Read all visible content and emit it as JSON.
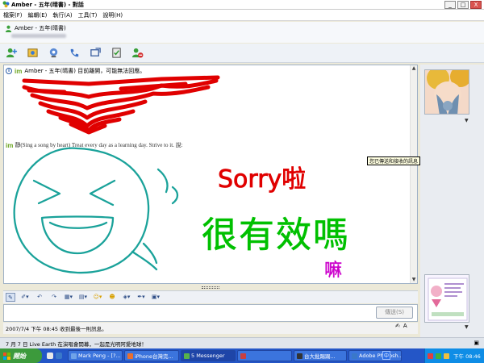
{
  "window": {
    "title": "Amber - 五年(晴書) - 對話",
    "minimize": "_",
    "maximize": "□",
    "close": "X"
  },
  "menu": [
    "檔案(F)",
    "編輯(E)",
    "執行(A)",
    "工具(T)",
    "說明(H)"
  ],
  "contact": {
    "name": "Amber - 五年(晴書)"
  },
  "conversation": {
    "away_notice": "Amber - 五年(晴書) 目前離開，可能無法回應。",
    "im_logo": "im",
    "message": "靜(Sing a song by heart) Treat every day as a learning day. Strive to it. 說:",
    "tooltip": "您已傳送和接收的訊息",
    "handwriting": {
      "line1": "Sorry啦",
      "line2": "很有效嗎",
      "line3": "嘛"
    }
  },
  "compose": {
    "send_label": "傳送(S)"
  },
  "status": {
    "last_message": "2007/7/4 下午 08:45 收到最後一則訊息。",
    "news": "7 月 7 日 Live Earth 在演唱會開幕，一起是光明阿愛地球！"
  },
  "taskbar": {
    "start_label": "開始",
    "items": [
      {
        "label": "Mark Peng - [?...",
        "color": "#6fa3e8"
      },
      {
        "label": "iPhone台灣完...",
        "color": "#e86f2e"
      },
      {
        "label": "5 Messenger",
        "color": "#58b24a"
      },
      {
        "label": "",
        "color": "#c84040"
      },
      {
        "label": "台大批踢踢...",
        "color": "#333333"
      },
      {
        "label": "Adobe Photosh...",
        "color": "#3a78c9"
      }
    ],
    "lang": "中",
    "clock": "下午 08:46"
  },
  "colors": {
    "red_ink": "#e00000",
    "green_ink": "#00c000",
    "teal_ink": "#1aa29a",
    "purple_ink": "#cc00cc"
  }
}
